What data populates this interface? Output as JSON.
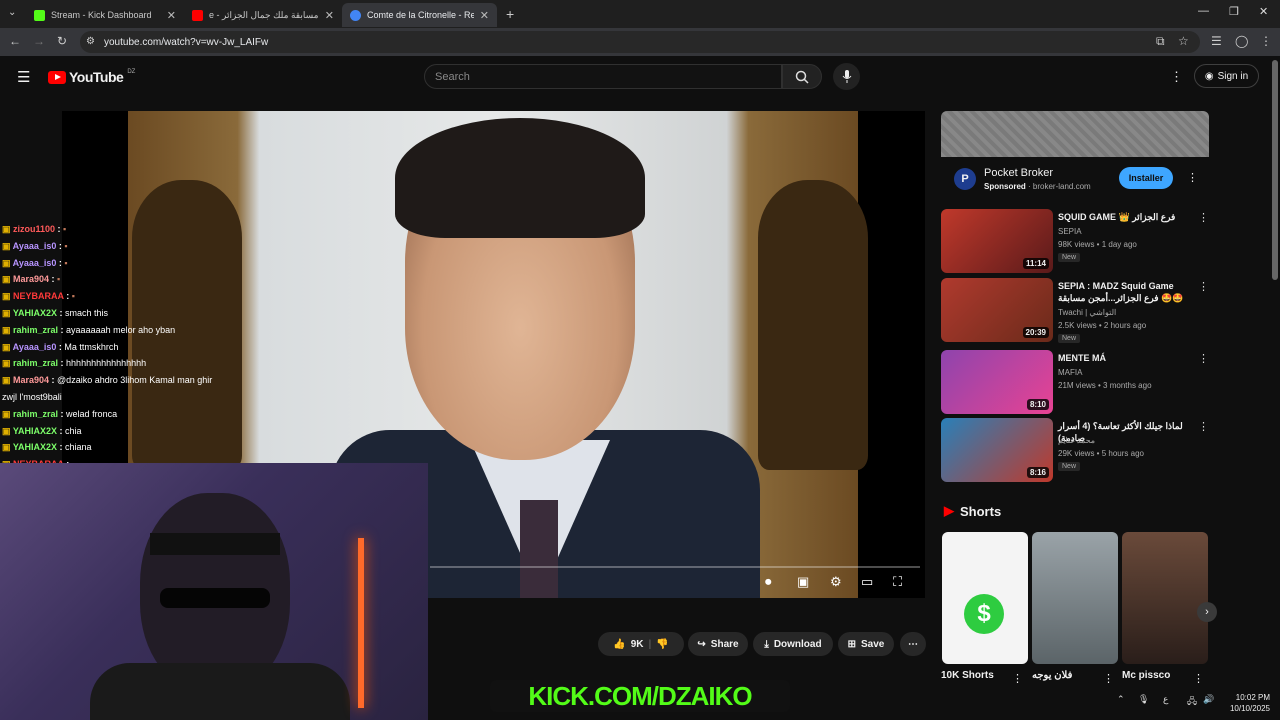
{
  "browser": {
    "tabs": [
      {
        "title": "Stream - Kick Dashboard",
        "color": "#53fc18"
      },
      {
        "title": "مسابقة ملك جمال الجزائر",
        "prefix": "e -",
        "color": "#ff0000"
      },
      {
        "title": "Comte de la Citronelle - Recher",
        "color": "#4285f4"
      }
    ],
    "url": "youtube.com/watch?v=wv-Jw_LAIFw"
  },
  "youtube": {
    "logo": "YouTube",
    "country": "DZ",
    "search_placeholder": "Search",
    "sign_in": "Sign in"
  },
  "chat": [
    {
      "user": "zizou1100",
      "color": "#ff5a5a",
      "msg": ""
    },
    {
      "user": "Ayaaa_is0",
      "color": "#b794ff",
      "msg": ""
    },
    {
      "user": "Ayaaa_is0",
      "color": "#b794ff",
      "msg": ""
    },
    {
      "user": "Mara904",
      "color": "#ff9a9a",
      "msg": ""
    },
    {
      "user": "NEYBARAA",
      "color": "#ff3a3a",
      "msg": ""
    },
    {
      "user": "YAHIAX2X",
      "color": "#7dff6a",
      "msg": "smach this"
    },
    {
      "user": "rahim_zral",
      "color": "#7dff6a",
      "msg": "ayaaaaaah melor aho yban"
    },
    {
      "user": "Ayaaa_is0",
      "color": "#b794ff",
      "msg": "Ma ttmskhrch"
    },
    {
      "user": "rahim_zral",
      "color": "#7dff6a",
      "msg": "hhhhhhhhhhhhhhhh"
    },
    {
      "user": "Mara904",
      "color": "#ff9a9a",
      "msg": "@dzaiko ahdro 3lihom Kamal man ghir"
    },
    {
      "user": "",
      "color": "#fff",
      "msg": "zwjl l'most9bali"
    },
    {
      "user": "rahim_zral",
      "color": "#7dff6a",
      "msg": "welad fronca"
    },
    {
      "user": "YAHIAX2X",
      "color": "#7dff6a",
      "msg": "chia"
    },
    {
      "user": "YAHIAX2X",
      "color": "#7dff6a",
      "msg": "chiana"
    },
    {
      "user": "NEYBARAA",
      "color": "#ff3a3a",
      "msg": ""
    }
  ],
  "actions": {
    "likes": "9K",
    "share": "Share",
    "download": "Download",
    "save": "Save"
  },
  "kick_banner": "KICK.COM/DZAIKO",
  "ad": {
    "name": "Pocket Broker",
    "sponsored": "Sponsored",
    "domain": "broker-land.com",
    "install": "Installer"
  },
  "recommendations": [
    {
      "title": "SQUID GAME 👑 فرع الجزائر",
      "channel": "SEPIA",
      "meta": "98K views • 1 day ago",
      "badge": "New",
      "duration": "11:14"
    },
    {
      "title": "SEPIA : MADZ Squid Game فرع الجزائر...أمجن مسابقة 🤩🤩",
      "channel": "Twachi | التواشي",
      "meta": "2.5K views • 2 hours ago",
      "badge": "New",
      "duration": "20:39"
    },
    {
      "title": "MENTE MÁ",
      "channel": "MAFIA",
      "meta": "21M views • 3 months ago",
      "badge": "",
      "duration": "8:10"
    },
    {
      "title": "لماذا جيلك الأكثر تعاسة؟ (4 أسرار صادمة)",
      "channel": "محمد غنايم",
      "meta": "29K views • 5 hours ago",
      "badge": "New",
      "duration": "8:16"
    }
  ],
  "shorts": {
    "heading": "Shorts",
    "items": [
      {
        "title": "10K Shorts"
      },
      {
        "title": "فلان يوجه"
      },
      {
        "title": "Mc pissco"
      }
    ]
  },
  "taskbar": {
    "time": "10:02 PM",
    "date": "10/10/2025"
  }
}
